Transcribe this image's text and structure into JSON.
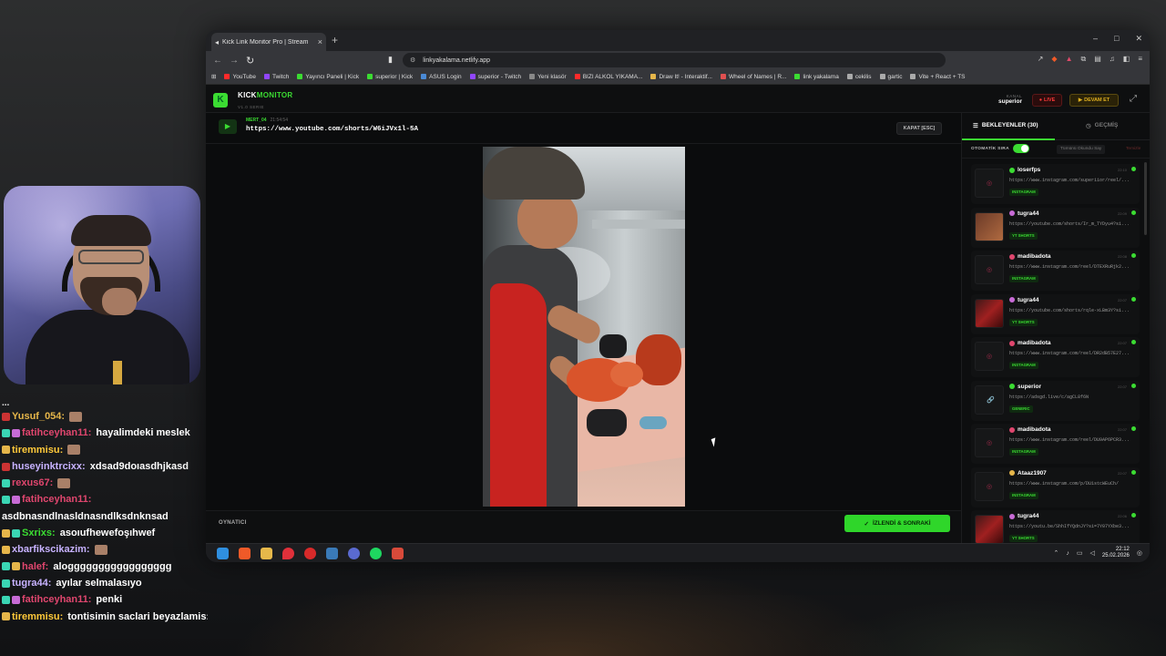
{
  "chat": [
    {
      "user": "",
      "text": "...",
      "color": "#e8e8e8",
      "cut": true
    },
    {
      "user": "Yusuf_054:",
      "text": "",
      "color": "#e6b64a",
      "badge": "#c33",
      "emote": true
    },
    {
      "user": "fatihceyhan11:",
      "text": "hayalimdeki meslek",
      "color": "#e0466e",
      "badge": "#3ad6b4",
      "badge2": "#c86bd6"
    },
    {
      "user": "tiremmisu:",
      "text": "",
      "color": "#ffc93a",
      "badge": "#e6b64a",
      "emote": true
    },
    {
      "user": "huseyinktrcixx:",
      "text": "xdsad9doıasdhjkasd",
      "color": "#c7b2ff",
      "badge": "#c33"
    },
    {
      "user": "rexus67:",
      "text": "",
      "color": "#e0466e",
      "badge": "#3ad6b4",
      "emote": true
    },
    {
      "user": "fatihceyhan11:",
      "text": "",
      "color": "#e0466e",
      "badge": "#3ad6b4",
      "badge2": "#c86bd6"
    },
    {
      "user": "",
      "text": "asdbnasndlnasldnasndlksdnknsad",
      "color": "#fff"
    },
    {
      "user": "Sxrixs:",
      "text": "asoıufhewefoşıhwef",
      "color": "#3bdc32",
      "badge": "#e6b64a",
      "badge2": "#3ad6b4"
    },
    {
      "user": "xbarfikscikazim:",
      "text": "",
      "color": "#c7b2ff",
      "badge": "#e6b64a",
      "emote": true
    },
    {
      "user": "halef:",
      "text": "aloggggggggggggggggg",
      "color": "#e0466e",
      "badge": "#3ad6b4",
      "badge2": "#e6b64a"
    },
    {
      "user": "tugra44:",
      "text": "ayılar selmalasıyo",
      "color": "#c7b2ff",
      "badge": "#3ad6b4"
    },
    {
      "user": "fatihceyhan11:",
      "text": "penki",
      "color": "#e0466e",
      "badge": "#3ad6b4",
      "badge2": "#c86bd6"
    },
    {
      "user": "tiremmisu:",
      "text": "tontisimin saclari beyazlamis:(",
      "color": "#ffc93a",
      "badge": "#e6b64a"
    }
  ],
  "browser": {
    "tab_title": "Kick Link Monitor Pro | Stream",
    "url": "linkyakalama.netlify.app",
    "bookmarks": [
      {
        "label": "YouTube",
        "color": "#ff2a2a"
      },
      {
        "label": "Twitch",
        "color": "#9146ff"
      },
      {
        "label": "Yayıncı Paneli | Kick",
        "color": "#3bdc32"
      },
      {
        "label": "superior | Kick",
        "color": "#3bdc32"
      },
      {
        "label": "ASUS Login",
        "color": "#4a8ad6"
      },
      {
        "label": "superior - Twitch",
        "color": "#9146ff"
      },
      {
        "label": "Yeni klasör",
        "color": "#888"
      },
      {
        "label": "BIZI ALKOL YIKAMA...",
        "color": "#ff2a2a"
      },
      {
        "label": "Draw It! - Interaktif...",
        "color": "#e6b64a"
      },
      {
        "label": "Wheel of Names | R...",
        "color": "#e05050"
      },
      {
        "label": "link yakalama",
        "color": "#3bdc32"
      },
      {
        "label": "cekilis",
        "color": "#aaa"
      },
      {
        "label": "gartic",
        "color": "#aaa"
      },
      {
        "label": "Vite + React + TS",
        "color": "#aaa"
      }
    ]
  },
  "app": {
    "brand_a": "KICK",
    "brand_b": "MONITOR",
    "version": "V1.0 SERIE",
    "kanal_label": "KANAL",
    "kanal_value": "superior",
    "live_label": "LIVE",
    "devam_label": "DEVAM ET",
    "np_user": "MERT_04",
    "np_time": "21:54:54",
    "np_url": "https://www.youtube.com/shorts/W6iJVx1l-5A",
    "kapat_label": "KAPAT [ESC]",
    "footer_label": "OYNATICI",
    "izlendi_label": "İZLENDİ & SONRAKİ",
    "tab_wait": "BEKLEYENLER (30)",
    "tab_past": "GEÇMİŞ",
    "oto_label": "OTOMATİK SIRA",
    "tumunu_label": "Tümünü Okundu Say",
    "temizle_label": "Temizle"
  },
  "queue": [
    {
      "user": "loserfps",
      "dot": "#3bdc32",
      "time": "22:10",
      "url": "https://www.instagram.com/superiior/reel/...",
      "tag": "INSTAGRAM",
      "thumb": "pin"
    },
    {
      "user": "tugra44",
      "dot": "#c86bd6",
      "time": "22:09",
      "url": "https://youtube.com/shorts/Ir_m_TYDyu4?si...",
      "tag": "YT SHORTS",
      "thumb": "img"
    },
    {
      "user": "madibadota",
      "dot": "#e0466e",
      "time": "22:08",
      "url": "https://www.instagram.com/reel/DTEXRuRjk2...",
      "tag": "INSTAGRAM",
      "thumb": "pin"
    },
    {
      "user": "tugra44",
      "dot": "#c86bd6",
      "time": "22:07",
      "url": "https://youtube.com/shorts/rqle-xLBm3Y?si...",
      "tag": "YT SHORTS",
      "thumb": "img2"
    },
    {
      "user": "madibadota",
      "dot": "#e0466e",
      "time": "22:07",
      "url": "https://www.instagram.com/reel/DR2dB57E27...",
      "tag": "INSTAGRAM",
      "thumb": "pin"
    },
    {
      "user": "superior",
      "dot": "#3bdc32",
      "time": "22:07",
      "url": "https://adsgd.live/c/agCL8f6N",
      "tag": "GENERIC",
      "thumb": "gen"
    },
    {
      "user": "madibadota",
      "dot": "#e0466e",
      "time": "22:07",
      "url": "https://www.instagram.com/reel/DU9AP6PCR3...",
      "tag": "INSTAGRAM",
      "thumb": "pin"
    },
    {
      "user": "Ataaz1907",
      "dot": "#e6b64a",
      "time": "22:07",
      "url": "https://www.instagram.com/p/DU1stcWEuCh/",
      "tag": "INSTAGRAM",
      "thumb": "pin"
    },
    {
      "user": "tugra44",
      "dot": "#c86bd6",
      "time": "22:06",
      "url": "https://youtu.be/ShhIfYQdnJY?si=7Y07YXbe3...",
      "tag": "YT SHORTS",
      "thumb": "img2"
    }
  ],
  "taskbar": {
    "time": "22:12",
    "date": "25.02.2026"
  }
}
